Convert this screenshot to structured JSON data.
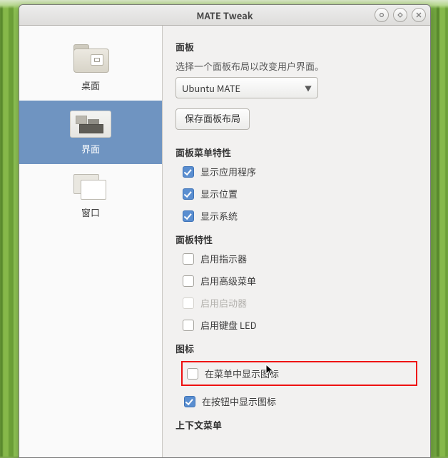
{
  "window": {
    "title": "MATE Tweak"
  },
  "sidebar": {
    "items": [
      {
        "label": "桌面"
      },
      {
        "label": "界面"
      },
      {
        "label": "窗口"
      }
    ]
  },
  "panel": {
    "heading": "面板",
    "hint": "选择一个面板布局以改变用户界面。",
    "layout_selected": "Ubuntu MATE",
    "save_btn": "保存面板布局"
  },
  "panel_menu": {
    "heading": "面板菜单特性",
    "show_apps": "显示应用程序",
    "show_places": "显示位置",
    "show_system": "显示系统"
  },
  "panel_feat": {
    "heading": "面板特性",
    "indicators": "启用指示器",
    "adv_menu": "启用高级菜单",
    "launcher": "启用启动器",
    "kb_led": "启用键盘 LED"
  },
  "icons": {
    "heading": "图标",
    "in_menus": "在菜单中显示图标",
    "in_buttons": "在按钮中显示图标"
  },
  "context": {
    "heading": "上下文菜单"
  }
}
